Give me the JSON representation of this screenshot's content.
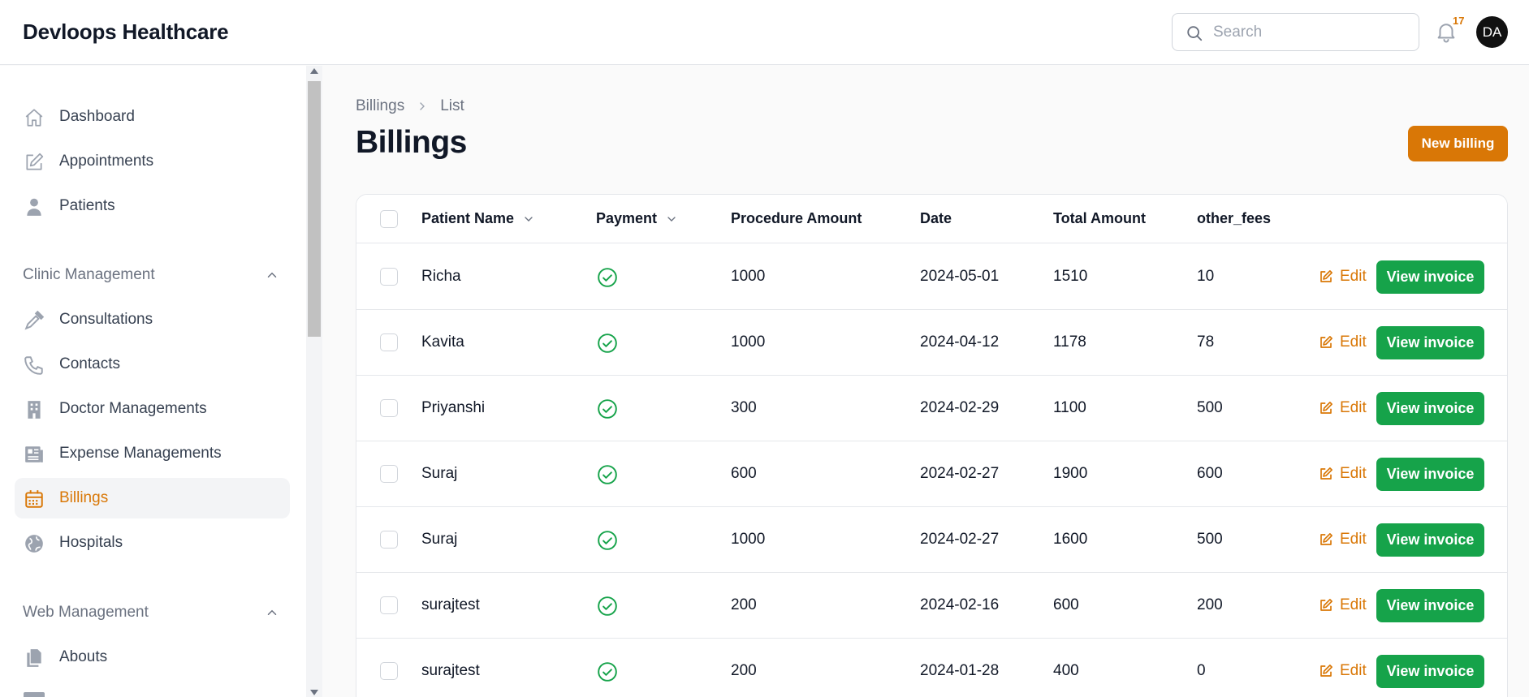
{
  "app": {
    "title": "Devloops Healthcare"
  },
  "search": {
    "placeholder": "Search",
    "value": ""
  },
  "notifications": {
    "count": "17"
  },
  "user": {
    "initials": "DA"
  },
  "sidebar": {
    "items": [
      {
        "label": "Dashboard",
        "icon": "home-icon"
      },
      {
        "label": "Appointments",
        "icon": "pencil-square-icon"
      },
      {
        "label": "Patients",
        "icon": "user-icon"
      }
    ],
    "groups": [
      {
        "label": "Clinic Management",
        "items": [
          {
            "label": "Consultations",
            "icon": "eyedropper-icon"
          },
          {
            "label": "Contacts",
            "icon": "phone-icon"
          },
          {
            "label": "Doctor Managements",
            "icon": "building-icon"
          },
          {
            "label": "Expense Managements",
            "icon": "newspaper-icon"
          },
          {
            "label": "Billings",
            "icon": "calendar-icon",
            "active": true
          },
          {
            "label": "Hospitals",
            "icon": "globe-icon"
          }
        ]
      },
      {
        "label": "Web Management",
        "items": [
          {
            "label": "Abouts",
            "icon": "documents-icon"
          }
        ]
      }
    ]
  },
  "breadcrumb": [
    "Billings",
    "List"
  ],
  "page": {
    "title": "Billings",
    "new_button": "New billing"
  },
  "table": {
    "headers": [
      "Patient Name",
      "Payment",
      "Procedure Amount",
      "Date",
      "Total Amount",
      "other_fees"
    ],
    "rows": [
      {
        "patient": "Richa",
        "paid": true,
        "procedure": "1000",
        "date": "2024-05-01",
        "total": "1510",
        "other_fees": "10"
      },
      {
        "patient": "Kavita",
        "paid": true,
        "procedure": "1000",
        "date": "2024-04-12",
        "total": "1178",
        "other_fees": "78"
      },
      {
        "patient": "Priyanshi",
        "paid": true,
        "procedure": "300",
        "date": "2024-02-29",
        "total": "1100",
        "other_fees": "500"
      },
      {
        "patient": "Suraj",
        "paid": true,
        "procedure": "600",
        "date": "2024-02-27",
        "total": "1900",
        "other_fees": "600"
      },
      {
        "patient": "Suraj",
        "paid": true,
        "procedure": "1000",
        "date": "2024-02-27",
        "total": "1600",
        "other_fees": "500"
      },
      {
        "patient": "surajtest",
        "paid": true,
        "procedure": "200",
        "date": "2024-02-16",
        "total": "600",
        "other_fees": "200"
      },
      {
        "patient": "surajtest",
        "paid": true,
        "procedure": "200",
        "date": "2024-01-28",
        "total": "400",
        "other_fees": "0"
      }
    ],
    "edit_label": "Edit",
    "view_label": "View invoice"
  },
  "colors": {
    "accent": "#d97706",
    "success": "#16a34a"
  }
}
